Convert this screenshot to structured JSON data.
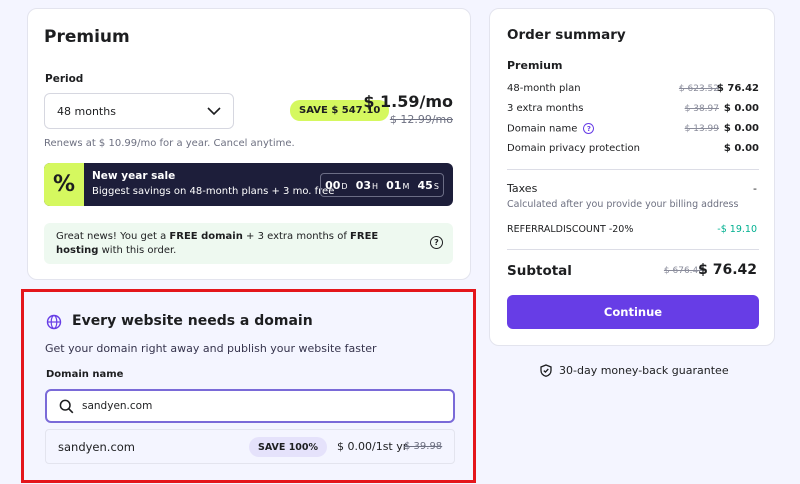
{
  "premium": {
    "title": "Premium",
    "period_label": "Period",
    "period_value": "48 months",
    "save_badge": "SAVE $ 547.10",
    "price": "$ 1.59/mo",
    "old_price": "$ 12.99/mo",
    "renews": "Renews at $ 10.99/mo for a year. Cancel anytime.",
    "sale": {
      "icon_text": "%",
      "title": "New year sale",
      "subtitle": "Biggest savings on 48-month plans + 3 mo. free",
      "countdown": {
        "days": "00",
        "days_unit": "D",
        "hours": "03",
        "hours_unit": "H",
        "minutes": "01",
        "minutes_unit": "M",
        "seconds": "45",
        "seconds_unit": "S"
      }
    },
    "free_banner": {
      "p1": "Great news! You get a ",
      "b1": "FREE domain",
      "p2": " + 3 extra months of ",
      "b2": "FREE hosting",
      "p3": " with this order."
    }
  },
  "domain": {
    "title": "Every website needs a domain",
    "subtitle": "Get your domain right away and publish your website faster",
    "field_label": "Domain name",
    "input_value": "sandyen.com",
    "result": {
      "name": "sandyen.com",
      "badge": "SAVE 100%",
      "price": "$ 0.00/1st yr",
      "old_price": "$ 39.98"
    }
  },
  "order": {
    "title": "Order summary",
    "plan_name": "Premium",
    "rows": [
      {
        "name": "48-month plan",
        "old": "$ 623.52",
        "value": "$ 76.42"
      },
      {
        "name": "3 extra months",
        "old": "$ 38.97",
        "value": "$ 0.00"
      },
      {
        "name": "Domain name",
        "old": "$ 13.99",
        "value": "$ 0.00"
      },
      {
        "name": "Domain privacy protection",
        "old": "",
        "value": "$ 0.00"
      }
    ],
    "taxes_label": "Taxes",
    "taxes_value": "-",
    "taxes_sub": "Calculated after you provide your billing address",
    "discount_label": "REFERRALDISCOUNT -20%",
    "discount_value": "-$ 19.10",
    "subtotal_label": "Subtotal",
    "subtotal_old": "$ 676.48",
    "subtotal_value": "$ 76.42",
    "continue_label": "Continue"
  },
  "guarantee": "30-day money-back guarantee",
  "colors": {
    "accent": "#673de6",
    "lime": "#d5f85f",
    "highlight_frame": "#e4161b"
  }
}
